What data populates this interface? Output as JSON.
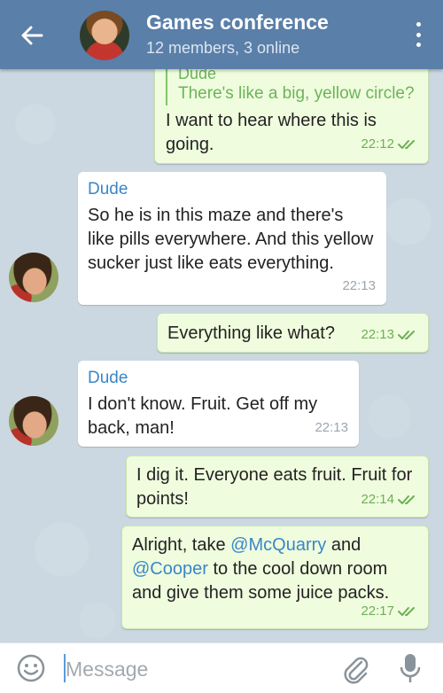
{
  "header": {
    "title": "Games conference",
    "subtitle": "12 members, 3 online",
    "back_icon": "arrow-left-icon",
    "menu_icon": "more-vertical-icon"
  },
  "colors": {
    "header_bg": "#5a7fa8",
    "outgoing_bubble": "#effdde",
    "incoming_bubble": "#ffffff",
    "sender_name": "#3a86c8",
    "read_ticks": "#6fae57"
  },
  "messages": [
    {
      "direction": "out",
      "reply": {
        "name": "Dude",
        "text": "There's like a big, yellow circle?"
      },
      "text": "I want to hear where this is going.",
      "time": "22:12",
      "status": "read"
    },
    {
      "direction": "in",
      "sender": "Dude",
      "text": "So he is in this maze and there's like pills everywhere. And this yellow sucker just like eats everything.",
      "time": "22:13"
    },
    {
      "direction": "out",
      "text": "Everything like what?",
      "time": "22:13",
      "status": "read"
    },
    {
      "direction": "in",
      "sender": "Dude",
      "text": "I don't know. Fruit. Get off my back, man!",
      "time": "22:13"
    },
    {
      "direction": "out",
      "text": "I dig it. Everyone eats fruit. Fruit for points!",
      "time": "22:14",
      "status": "read"
    },
    {
      "direction": "out",
      "text_parts": [
        "Alright, take ",
        "@McQuarry",
        " and ",
        "@Cooper",
        " to the cool down room and give them some juice packs."
      ],
      "time": "22:17",
      "status": "read"
    }
  ],
  "input": {
    "placeholder": "Message",
    "value": "",
    "emoji_icon": "smile-icon",
    "attach_icon": "paperclip-icon",
    "mic_icon": "microphone-icon"
  }
}
